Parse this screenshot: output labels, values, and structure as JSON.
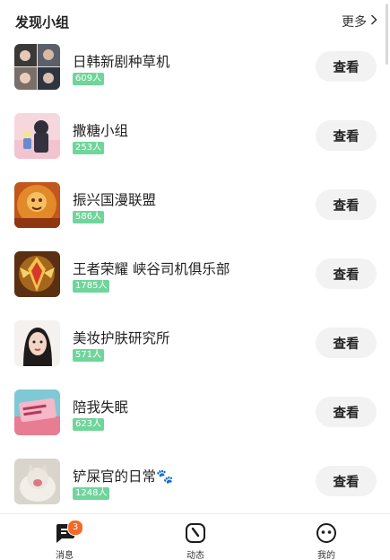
{
  "header": {
    "title": "发现小组",
    "more_label": "更多"
  },
  "groups": [
    {
      "name": "日韩新剧种草机",
      "members": "609人",
      "button": "查看"
    },
    {
      "name": "撒糖小组",
      "members": "253人",
      "button": "查看"
    },
    {
      "name": "振兴国漫联盟",
      "members": "586人",
      "button": "查看"
    },
    {
      "name": "王者荣耀 峡谷司机俱乐部",
      "members": "1785人",
      "button": "查看"
    },
    {
      "name": "美妆护肤研究所",
      "members": "571人",
      "button": "查看"
    },
    {
      "name": "陪我失眠",
      "members": "623人",
      "button": "查看"
    },
    {
      "name": "铲屎官的日常🐾",
      "members": "1248人",
      "button": "查看"
    }
  ],
  "tabbar": {
    "messages": {
      "label": "消息",
      "badge": "3"
    },
    "feed": {
      "label": "动态"
    },
    "me": {
      "label": "我的"
    }
  },
  "colors": {
    "member_badge": "#6fd59a",
    "notification_badge": "#f06a2a",
    "button_bg": "#f2f2f2"
  }
}
